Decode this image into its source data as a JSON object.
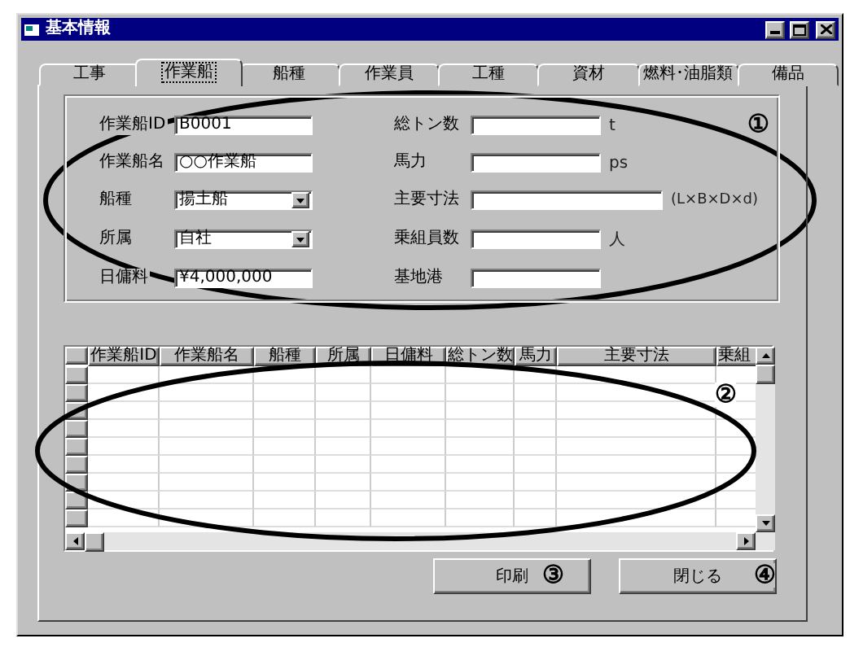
{
  "window": {
    "title": "基本情報"
  },
  "tabs": [
    {
      "label": "工事",
      "selected": false
    },
    {
      "label": "作業船",
      "selected": true
    },
    {
      "label": "船種",
      "selected": false
    },
    {
      "label": "作業員",
      "selected": false
    },
    {
      "label": "工種",
      "selected": false
    },
    {
      "label": "資材",
      "selected": false
    },
    {
      "label": "燃料･油脂類",
      "selected": false
    },
    {
      "label": "備品",
      "selected": false
    }
  ],
  "form": {
    "left": [
      {
        "label": "作業船ID",
        "kind": "text",
        "value": "B0001"
      },
      {
        "label": "作業船名",
        "kind": "text",
        "value": "○○作業船"
      },
      {
        "label": "船種",
        "kind": "select",
        "value": "揚土船"
      },
      {
        "label": "所属",
        "kind": "select",
        "value": "自社"
      },
      {
        "label": "日傭料",
        "kind": "text",
        "value": "¥4,000,000"
      }
    ],
    "right": [
      {
        "label": "総トン数",
        "kind": "text",
        "unit": "t"
      },
      {
        "label": "馬力",
        "kind": "text",
        "unit": "ps"
      },
      {
        "label": "主要寸法",
        "kind": "wide",
        "unit": "(L×B×D×d)"
      },
      {
        "label": "乗組員数",
        "kind": "text",
        "unit": "人"
      },
      {
        "label": "基地港",
        "kind": "text"
      }
    ]
  },
  "table": {
    "columns": [
      "作業船ID",
      "作業船名",
      "船種",
      "所属",
      "日傭料",
      "総トン数",
      "馬力",
      "主要寸法",
      "乗組"
    ]
  },
  "buttons": [
    "印刷",
    "閉じる"
  ],
  "annotations": [
    {
      "text": "①"
    },
    {
      "text": "②"
    },
    {
      "text": "③"
    },
    {
      "text": "④"
    }
  ]
}
